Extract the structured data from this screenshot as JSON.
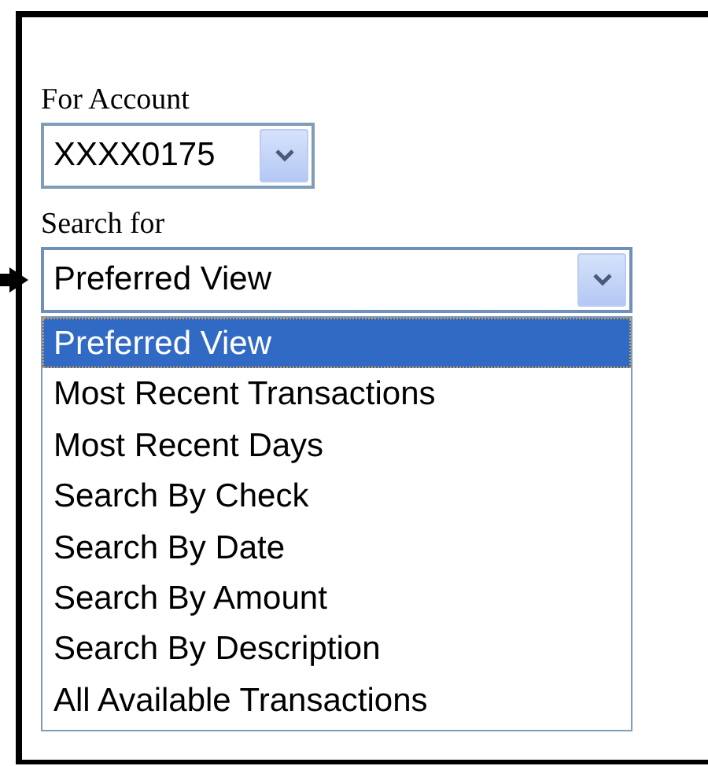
{
  "account": {
    "label": "For Account",
    "value": "XXXX0175"
  },
  "search": {
    "label": "Search for",
    "value": "Preferred View",
    "expanded": true,
    "options": [
      {
        "label": "Preferred View",
        "selected": true
      },
      {
        "label": "Most Recent Transactions",
        "selected": false
      },
      {
        "label": "Most Recent Days",
        "selected": false
      },
      {
        "label": "Search By Check",
        "selected": false
      },
      {
        "label": "Search By Date",
        "selected": false
      },
      {
        "label": "Search By Amount",
        "selected": false
      },
      {
        "label": "Search By Description",
        "selected": false
      },
      {
        "label": "All Available Transactions",
        "selected": false
      }
    ]
  }
}
